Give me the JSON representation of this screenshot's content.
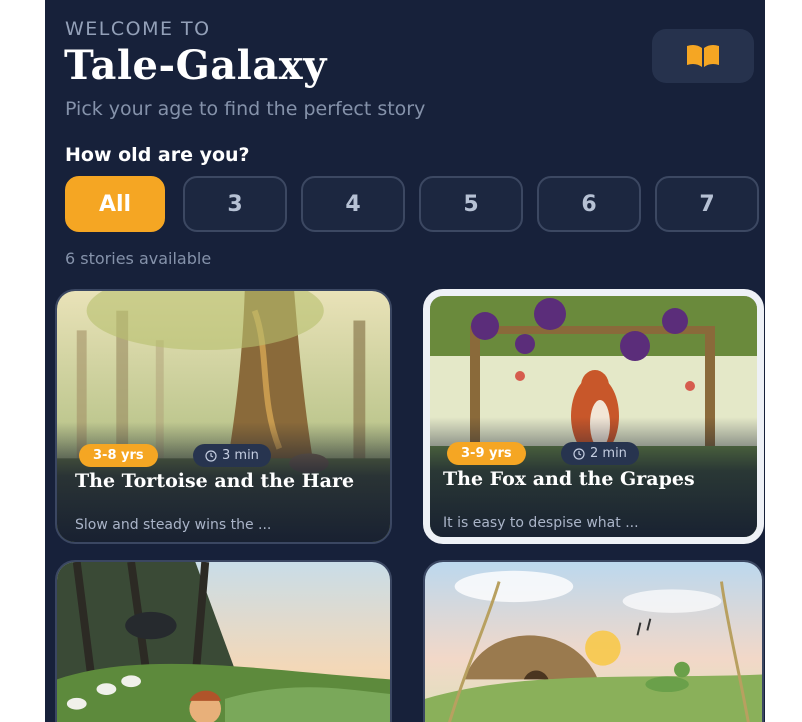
{
  "header": {
    "welcome": "WELCOME TO",
    "title": "Tale-Galaxy",
    "subtitle": "Pick your age to find the perfect story",
    "book_icon": "open-book-icon"
  },
  "age_filter": {
    "question": "How old are you?",
    "options": [
      "All",
      "3",
      "4",
      "5",
      "6",
      "7"
    ],
    "selected": "All"
  },
  "stories_count": "6 stories available",
  "colors": {
    "background": "#17213a",
    "accent": "#f5a623",
    "card_border": "#3b4762"
  },
  "stories": [
    {
      "title": "The Tortoise and the Hare",
      "age": "3-8 yrs",
      "duration": "3 min",
      "description": "Slow and steady wins the ..."
    },
    {
      "title": "The Fox and the Grapes",
      "age": "3-9 yrs",
      "duration": "2 min",
      "description": "It is easy to despise what ..."
    },
    {
      "title": "",
      "age": "",
      "duration": "",
      "description": ""
    },
    {
      "title": "",
      "age": "",
      "duration": "",
      "description": ""
    }
  ]
}
